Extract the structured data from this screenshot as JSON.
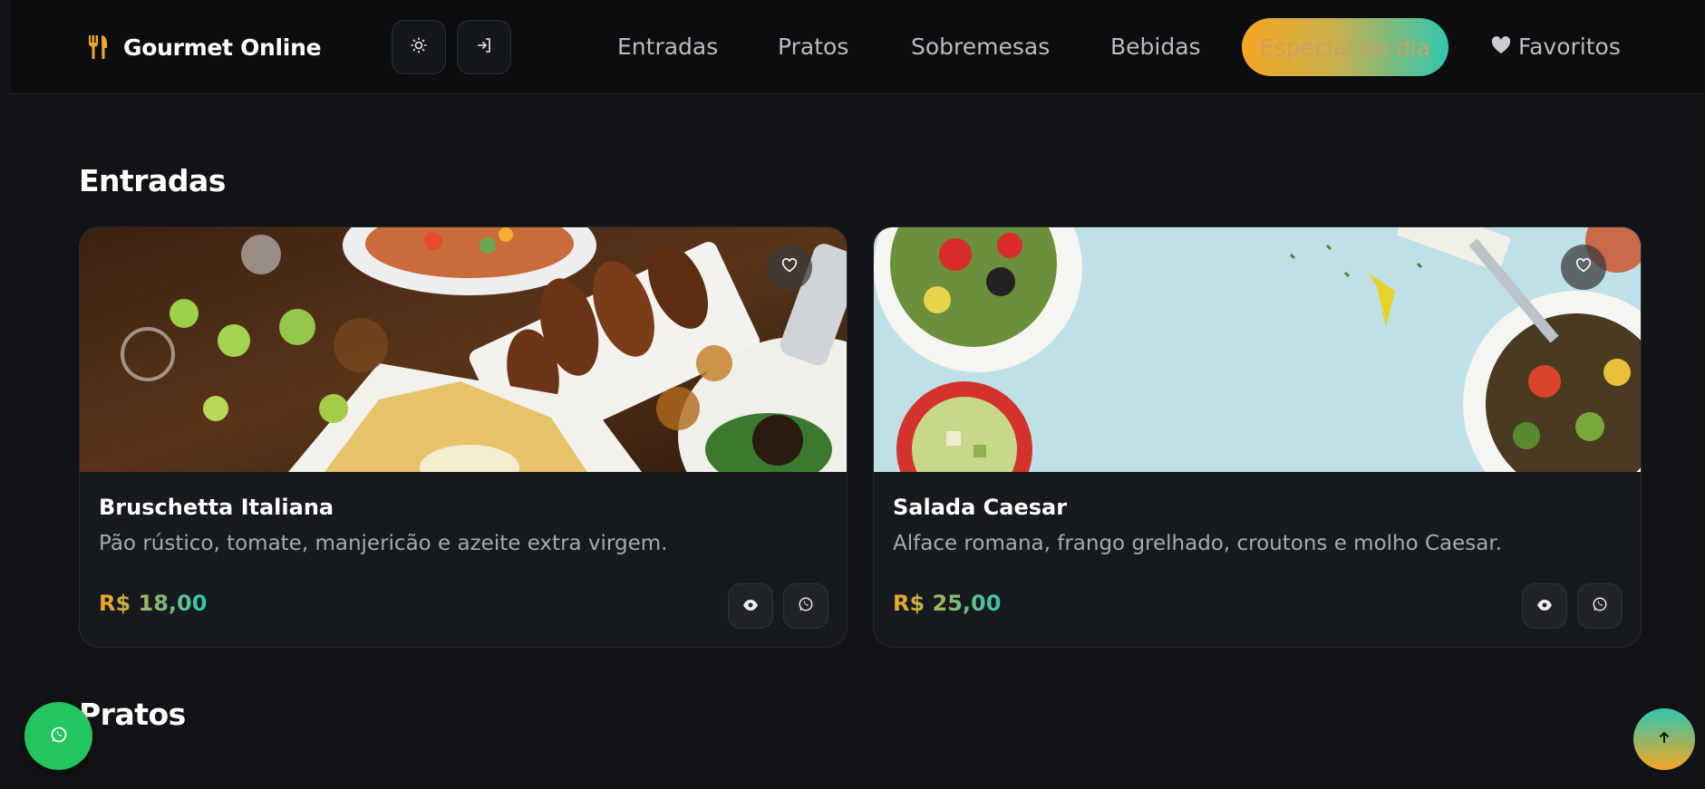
{
  "brand": {
    "name": "Gourmet Online",
    "icon": "utensils-icon",
    "accent": "#f5a623"
  },
  "header_buttons": [
    {
      "icon": "sun-icon"
    },
    {
      "icon": "sign-in-icon"
    }
  ],
  "nav": {
    "items": [
      "Entradas",
      "Pratos",
      "Sobremesas",
      "Bebidas"
    ],
    "special": "Especial do dia",
    "favorites": "Favoritos"
  },
  "sections": [
    {
      "title": "Entradas",
      "cards": [
        {
          "title": "Bruschetta Italiana",
          "description": "Pão rústico, tomate, manjericão e azeite extra virgem.",
          "price": "R$ 18,00"
        },
        {
          "title": "Salada Caesar",
          "description": "Alface romana, frango grelhado, croutons e molho Caesar.",
          "price": "R$ 25,00"
        }
      ]
    },
    {
      "title": "Pratos"
    }
  ],
  "colors": {
    "background": "#111316",
    "gradient_start": "#f5a623",
    "gradient_end": "#2fc7b0",
    "whatsapp": "#22c55e"
  }
}
